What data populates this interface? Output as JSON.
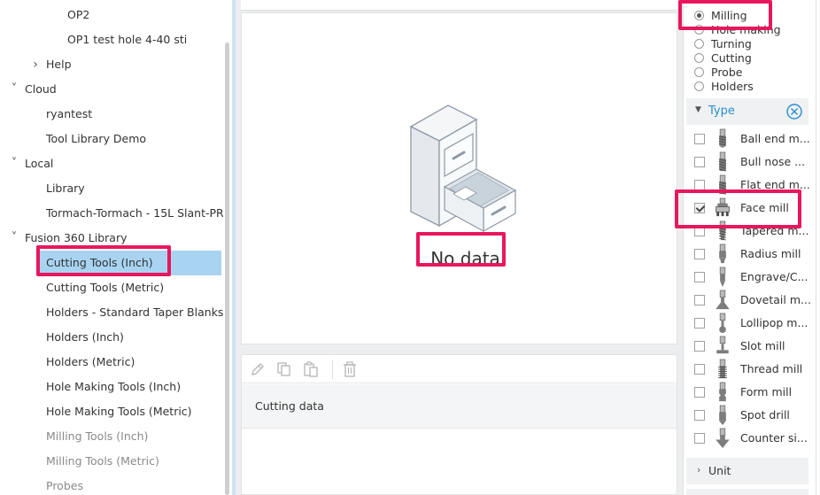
{
  "tree": {
    "items": [
      {
        "label": "OP2",
        "indent": 3,
        "arrow": ""
      },
      {
        "label": "OP1 test hole 4-40 sti",
        "indent": 3,
        "arrow": ""
      },
      {
        "label": "Help",
        "indent": 2,
        "arrow": ">"
      },
      {
        "label": "Cloud",
        "indent": 1,
        "arrow": "v"
      },
      {
        "label": "ryantest",
        "indent": 2,
        "arrow": ""
      },
      {
        "label": "Tool Library Demo",
        "indent": 2,
        "arrow": ""
      },
      {
        "label": "Local",
        "indent": 1,
        "arrow": "v"
      },
      {
        "label": "Library",
        "indent": 2,
        "arrow": ""
      },
      {
        "label": "Tormach-Tormach - 15L Slant-PRO",
        "indent": 2,
        "arrow": ""
      },
      {
        "label": "Fusion 360 Library",
        "indent": 1,
        "arrow": "v"
      },
      {
        "label": "Cutting Tools (Inch)",
        "indent": 2,
        "arrow": "",
        "selected": true
      },
      {
        "label": "Cutting Tools (Metric)",
        "indent": 2,
        "arrow": ""
      },
      {
        "label": "Holders - Standard Taper Blanks",
        "indent": 2,
        "arrow": ""
      },
      {
        "label": "Holders (Inch)",
        "indent": 2,
        "arrow": ""
      },
      {
        "label": "Holders (Metric)",
        "indent": 2,
        "arrow": ""
      },
      {
        "label": "Hole Making Tools (Inch)",
        "indent": 2,
        "arrow": ""
      },
      {
        "label": "Hole Making Tools (Metric)",
        "indent": 2,
        "arrow": ""
      },
      {
        "label": "Milling Tools (Inch)",
        "indent": 2,
        "arrow": "",
        "muted": true
      },
      {
        "label": "Milling Tools (Metric)",
        "indent": 2,
        "arrow": "",
        "muted": true
      },
      {
        "label": "Probes",
        "indent": 2,
        "arrow": "",
        "muted": true
      }
    ]
  },
  "main": {
    "empty_text": "No data",
    "toolbar_icons": [
      "pencil-icon",
      "copy-icon",
      "paste-icon",
      "trash-icon"
    ],
    "cutting_data_label": "Cutting data"
  },
  "filters": {
    "categories": [
      {
        "label": "Milling",
        "selected": true
      },
      {
        "label": "Hole making",
        "selected": false
      },
      {
        "label": "Turning",
        "selected": false
      },
      {
        "label": "Cutting",
        "selected": false
      },
      {
        "label": "Probe",
        "selected": false
      },
      {
        "label": "Holders",
        "selected": false
      }
    ],
    "type_title": "Type",
    "types": [
      {
        "label": "Ball end m...",
        "checked": false,
        "icon": "ball-end-mill-icon"
      },
      {
        "label": "Bull nose ...",
        "checked": false,
        "icon": "bull-nose-mill-icon"
      },
      {
        "label": "Flat end m...",
        "checked": false,
        "icon": "flat-end-mill-icon"
      },
      {
        "label": "Face mill",
        "checked": true,
        "icon": "face-mill-icon"
      },
      {
        "label": "Tapered m...",
        "checked": false,
        "icon": "tapered-mill-icon"
      },
      {
        "label": "Radius mill",
        "checked": false,
        "icon": "radius-mill-icon"
      },
      {
        "label": "Engrave/C...",
        "checked": false,
        "icon": "engrave-chamfer-icon"
      },
      {
        "label": "Dovetail m...",
        "checked": false,
        "icon": "dovetail-mill-icon"
      },
      {
        "label": "Lollipop m...",
        "checked": false,
        "icon": "lollipop-mill-icon"
      },
      {
        "label": "Slot mill",
        "checked": false,
        "icon": "slot-mill-icon"
      },
      {
        "label": "Thread mill",
        "checked": false,
        "icon": "thread-mill-icon"
      },
      {
        "label": "Form mill",
        "checked": false,
        "icon": "form-mill-icon"
      },
      {
        "label": "Spot drill",
        "checked": false,
        "icon": "spot-drill-icon"
      },
      {
        "label": "Counter si...",
        "checked": false,
        "icon": "countersink-icon"
      }
    ],
    "unit_title": "Unit"
  },
  "colors": {
    "highlight": "#e8175d",
    "selection": "#a8d4f2",
    "accent": "#2a8fcf"
  }
}
